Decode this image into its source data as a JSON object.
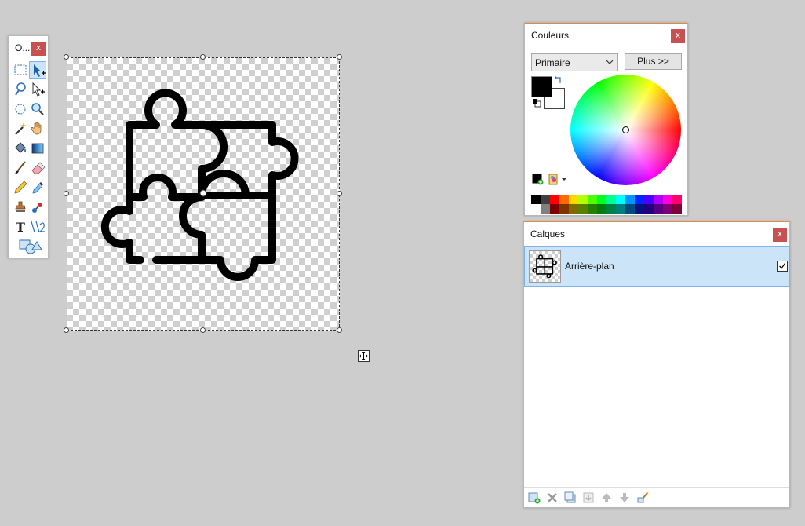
{
  "tools_window": {
    "title": "O...",
    "close": "x",
    "tools": [
      {
        "name": "rectangle-select-tool-icon"
      },
      {
        "name": "move-selected-pixels-tool-icon"
      },
      {
        "name": "lasso-select-tool-icon"
      },
      {
        "name": "move-selection-tool-icon"
      },
      {
        "name": "ellipse-select-tool-icon"
      },
      {
        "name": "zoom-tool-icon"
      },
      {
        "name": "magic-wand-tool-icon"
      },
      {
        "name": "pan-tool-icon"
      },
      {
        "name": "paint-bucket-tool-icon"
      },
      {
        "name": "gradient-tool-icon"
      },
      {
        "name": "paintbrush-tool-icon"
      },
      {
        "name": "eraser-tool-icon"
      },
      {
        "name": "pencil-tool-icon"
      },
      {
        "name": "color-picker-tool-icon"
      },
      {
        "name": "clone-stamp-tool-icon"
      },
      {
        "name": "recolor-tool-icon"
      },
      {
        "name": "text-tool-icon"
      },
      {
        "name": "line-curve-tool-icon"
      },
      {
        "name": "shapes-tool-icon"
      }
    ]
  },
  "colors_window": {
    "title": "Couleurs",
    "close": "x",
    "mode_select": "Primaire",
    "more_button": "Plus >>",
    "primary_color": "#000000",
    "secondary_color": "#ffffff",
    "palette_top": [
      "#000000",
      "#404040",
      "#ff0000",
      "#ff6a00",
      "#ffd800",
      "#b6ff00",
      "#4cff00",
      "#00ff21",
      "#00ff90",
      "#00ffff",
      "#0094ff",
      "#0026ff",
      "#4800ff",
      "#b200ff",
      "#ff00dc",
      "#ff006e"
    ],
    "palette_bottom": [
      "#ffffff",
      "#808080",
      "#7f0000",
      "#7f3300",
      "#7f6a00",
      "#5b7f00",
      "#267f00",
      "#007f0e",
      "#007f46",
      "#007f7f",
      "#004a7f",
      "#00137f",
      "#21007f",
      "#57007f",
      "#7f006e",
      "#7f0037"
    ]
  },
  "layers_window": {
    "title": "Calques",
    "close": "x",
    "layers": [
      {
        "name": "Arrière-plan",
        "visible": true
      }
    ]
  },
  "colors": {
    "accent": "#e08a4a",
    "selection_bg": "#cce4f7",
    "close_bg": "#c75050"
  }
}
